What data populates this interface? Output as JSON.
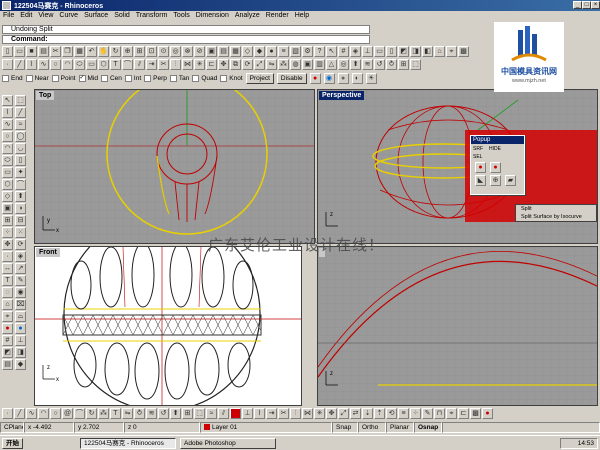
{
  "window": {
    "title": "122504马赛克 - Rhinoceros",
    "controls": [
      "_",
      "□",
      "×"
    ]
  },
  "menu": [
    "File",
    "Edit",
    "View",
    "Curve",
    "Surface",
    "Solid",
    "Transform",
    "Tools",
    "Dimension",
    "Analyze",
    "Render",
    "Help"
  ],
  "command": {
    "history": "Undoing Split",
    "label": "Command:",
    "value": ""
  },
  "osnap": {
    "items": [
      {
        "label": "End",
        "checked": false
      },
      {
        "label": "Near",
        "checked": false
      },
      {
        "label": "Point",
        "checked": false
      },
      {
        "label": "Mid",
        "checked": true
      },
      {
        "label": "Cen",
        "checked": false
      },
      {
        "label": "Int",
        "checked": false
      },
      {
        "label": "Perp",
        "checked": false
      },
      {
        "label": "Tan",
        "checked": false
      },
      {
        "label": "Quad",
        "checked": false
      },
      {
        "label": "Knot",
        "checked": false
      }
    ],
    "project_label": "Project",
    "disable_label": "Disable"
  },
  "viewports": {
    "top": "Top",
    "perspective": "Perspective",
    "front": "Front",
    "right": ""
  },
  "popup": {
    "title": "Popup",
    "labels": [
      "SRF",
      "SEL",
      "HIDE"
    ],
    "split_items": [
      "Split",
      "Split Surface by Isocurve"
    ]
  },
  "watermark": "广东艾伦工业设计在线！",
  "logo_text": "中国模具资讯网",
  "logo_sub": "www.mjzh.net",
  "status": {
    "cplane": "CPlane",
    "x": "x -4.492",
    "y": "y 2.702",
    "z": "z 0",
    "layer": "Layer 01",
    "snap": "Snap",
    "ortho": "Ortho",
    "planar": "Planar",
    "osnap": "Osnap"
  },
  "taskbar": {
    "start": "开始",
    "tasks": [
      "122504马赛克 - Rhinoceros",
      "Adobe Photoshop"
    ],
    "clock": "14:53"
  },
  "colors": {
    "title_bar": "#0a246a",
    "popup_highlight": "#d40000",
    "curve_yellow": "#e8d000",
    "curve_red": "#c00000"
  }
}
